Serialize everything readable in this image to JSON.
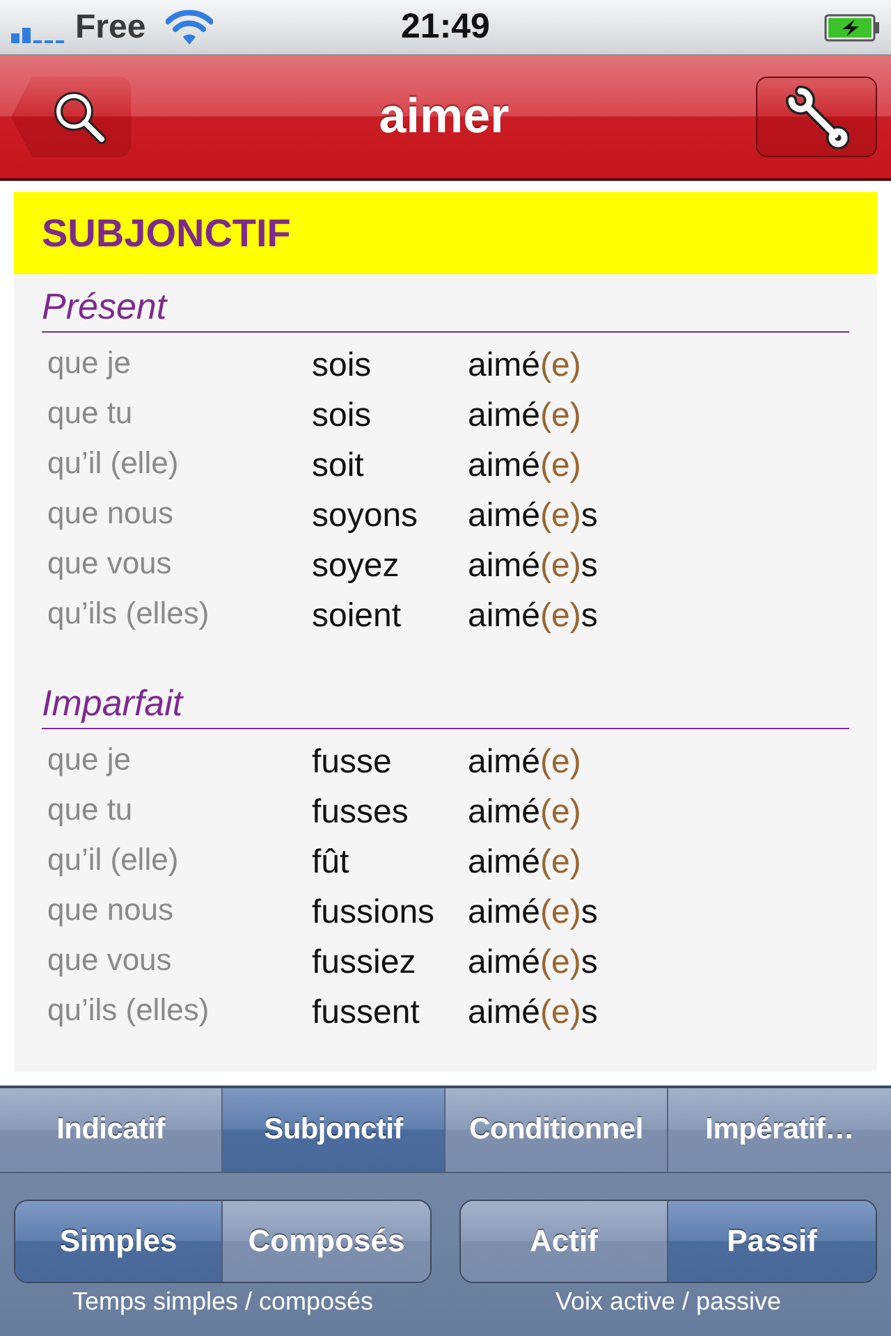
{
  "status_bar": {
    "carrier": "Free",
    "time": "21:49"
  },
  "nav_bar": {
    "title": "aimer"
  },
  "mood": {
    "title": "SUBJONCTIF"
  },
  "tenses": [
    {
      "name": "Présent",
      "rows": [
        {
          "pronoun": "que je",
          "auxiliary": "sois",
          "participle": [
            {
              "text": "aimé",
              "kind": "base"
            },
            {
              "text": "(e)",
              "kind": "optional"
            }
          ]
        },
        {
          "pronoun": "que tu",
          "auxiliary": "sois",
          "participle": [
            {
              "text": "aimé",
              "kind": "base"
            },
            {
              "text": "(e)",
              "kind": "optional"
            }
          ]
        },
        {
          "pronoun": "qu’il (elle)",
          "auxiliary": "soit",
          "participle": [
            {
              "text": "aimé",
              "kind": "base"
            },
            {
              "text": "(e)",
              "kind": "optional"
            }
          ]
        },
        {
          "pronoun": "que nous",
          "auxiliary": "soyons",
          "participle": [
            {
              "text": "aimé",
              "kind": "base"
            },
            {
              "text": "(e)",
              "kind": "optional"
            },
            {
              "text": "s",
              "kind": "base"
            }
          ]
        },
        {
          "pronoun": "que vous",
          "auxiliary": "soyez",
          "participle": [
            {
              "text": "aimé",
              "kind": "base"
            },
            {
              "text": "(e)",
              "kind": "optional"
            },
            {
              "text": "s",
              "kind": "base"
            }
          ]
        },
        {
          "pronoun": "qu’ils (elles)",
          "auxiliary": "soient",
          "participle": [
            {
              "text": "aimé",
              "kind": "base"
            },
            {
              "text": "(e)",
              "kind": "optional"
            },
            {
              "text": "s",
              "kind": "base"
            }
          ]
        }
      ]
    },
    {
      "name": "Imparfait",
      "rows": [
        {
          "pronoun": "que je",
          "auxiliary": "fusse",
          "participle": [
            {
              "text": "aimé",
              "kind": "base"
            },
            {
              "text": "(e)",
              "kind": "optional"
            }
          ]
        },
        {
          "pronoun": "que tu",
          "auxiliary": "fusses",
          "participle": [
            {
              "text": "aimé",
              "kind": "base"
            },
            {
              "text": "(e)",
              "kind": "optional"
            }
          ]
        },
        {
          "pronoun": "qu’il (elle)",
          "auxiliary": "fût",
          "participle": [
            {
              "text": "aimé",
              "kind": "base"
            },
            {
              "text": "(e)",
              "kind": "optional"
            }
          ]
        },
        {
          "pronoun": "que nous",
          "auxiliary": "fussions",
          "participle": [
            {
              "text": "aimé",
              "kind": "base"
            },
            {
              "text": "(e)",
              "kind": "optional"
            },
            {
              "text": "s",
              "kind": "base"
            }
          ]
        },
        {
          "pronoun": "que vous",
          "auxiliary": "fussiez",
          "participle": [
            {
              "text": "aimé",
              "kind": "base"
            },
            {
              "text": "(e)",
              "kind": "optional"
            },
            {
              "text": "s",
              "kind": "base"
            }
          ]
        },
        {
          "pronoun": "qu’ils (elles)",
          "auxiliary": "fussent",
          "participle": [
            {
              "text": "aimé",
              "kind": "base"
            },
            {
              "text": "(e)",
              "kind": "optional"
            },
            {
              "text": "s",
              "kind": "base"
            }
          ]
        }
      ]
    }
  ],
  "mood_tabs": [
    {
      "label": "Indicatif",
      "selected": false
    },
    {
      "label": "Subjonctif",
      "selected": true
    },
    {
      "label": "Conditionnel",
      "selected": false
    },
    {
      "label": "Impératif…",
      "selected": false
    }
  ],
  "tense_toggle": {
    "options": [
      {
        "label": "Simples",
        "selected": true
      },
      {
        "label": "Composés",
        "selected": false
      }
    ],
    "caption": "Temps simples / composés"
  },
  "voice_toggle": {
    "options": [
      {
        "label": "Actif",
        "selected": false
      },
      {
        "label": "Passif",
        "selected": true
      }
    ],
    "caption": "Voix active / passive"
  }
}
